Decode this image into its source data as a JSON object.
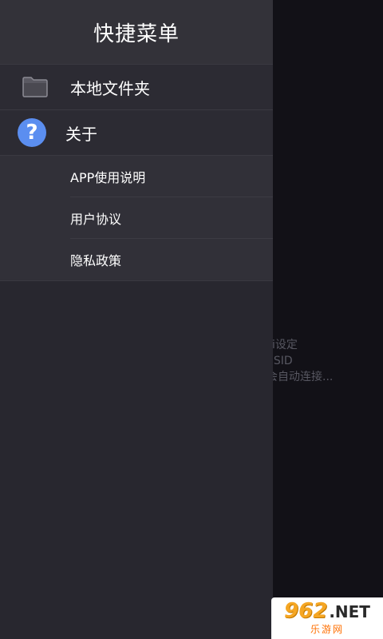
{
  "drawer": {
    "title": "快捷菜单",
    "items": [
      {
        "label": "本地文件夹",
        "icon": "folder-icon"
      },
      {
        "label": "关于",
        "icon": "help-icon"
      }
    ],
    "help_glyph": "?",
    "submenu": [
      {
        "label": "APP使用说明"
      },
      {
        "label": "用户协议"
      },
      {
        "label": "隐私政策"
      }
    ]
  },
  "background": {
    "lines": [
      "Fi设定",
      "SSID",
      "会自动连接..."
    ]
  },
  "watermark": {
    "number": "962",
    "suffix": ".NET",
    "site": "乐游网"
  },
  "colors": {
    "drawer_bg": "#28272f",
    "header_bg": "#333239",
    "help_icon_bg": "#5b8ef0",
    "screen_bg": "#121117"
  }
}
